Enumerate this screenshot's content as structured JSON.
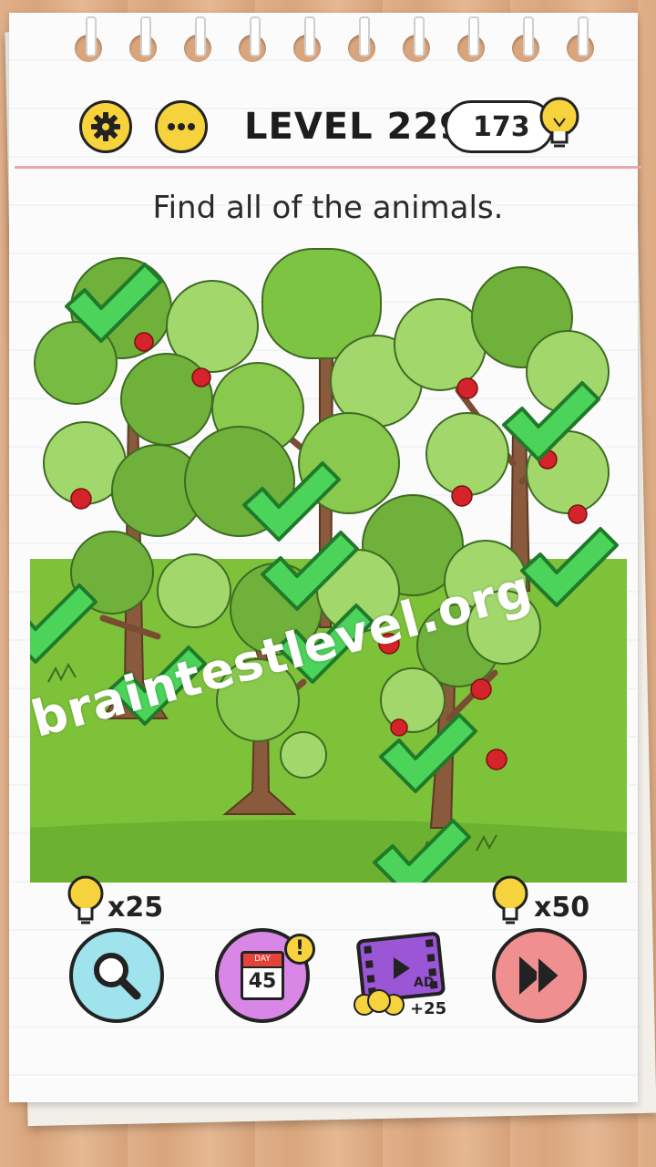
{
  "header": {
    "level_title": "LEVEL 229",
    "hint_count": "173",
    "settings_icon": "gear-icon",
    "more_icon": "ellipsis-icon",
    "hint_icon": "lightbulb-icon"
  },
  "instruction": "Find all of the animals.",
  "scene": {
    "found_marks": 11,
    "check_color": "#4cd35a",
    "grass_color": "#7ec23a",
    "apple_color": "#d4232a"
  },
  "bottom_bar": {
    "hint_button": {
      "icon": "magnifier-icon",
      "cost": "x25"
    },
    "daily_button": {
      "day_label": "DAY",
      "day_number": "45",
      "badge": "!"
    },
    "ad_button": {
      "label": "AD",
      "reward": "+25"
    },
    "skip_button": {
      "icon": "skip-icon",
      "cost": "x50"
    }
  },
  "watermark": "braintestlevel.org"
}
